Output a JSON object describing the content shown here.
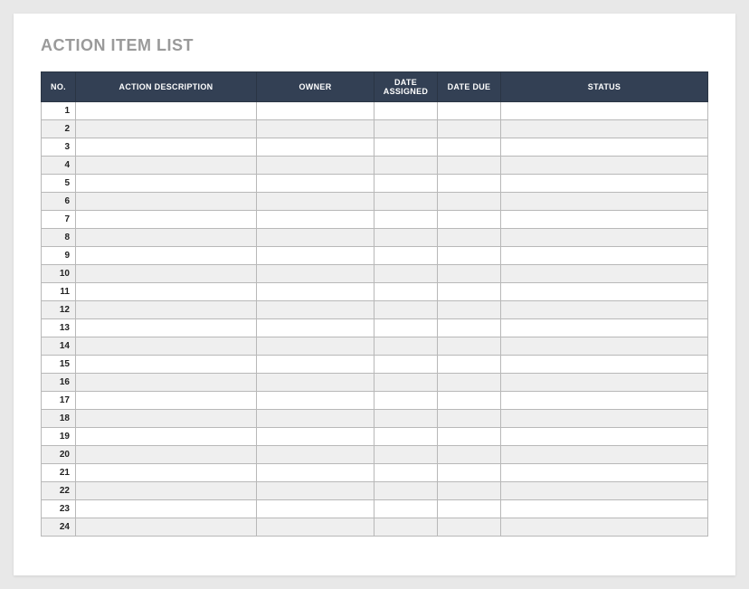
{
  "title": "ACTION ITEM LIST",
  "columns": {
    "no": "NO.",
    "description": "ACTION DESCRIPTION",
    "owner": "OWNER",
    "dateAssigned": "DATE ASSIGNED",
    "dateDue": "DATE DUE",
    "status": "STATUS"
  },
  "rows": [
    {
      "no": "1",
      "description": "",
      "owner": "",
      "dateAssigned": "",
      "dateDue": "",
      "status": ""
    },
    {
      "no": "2",
      "description": "",
      "owner": "",
      "dateAssigned": "",
      "dateDue": "",
      "status": ""
    },
    {
      "no": "3",
      "description": "",
      "owner": "",
      "dateAssigned": "",
      "dateDue": "",
      "status": ""
    },
    {
      "no": "4",
      "description": "",
      "owner": "",
      "dateAssigned": "",
      "dateDue": "",
      "status": ""
    },
    {
      "no": "5",
      "description": "",
      "owner": "",
      "dateAssigned": "",
      "dateDue": "",
      "status": ""
    },
    {
      "no": "6",
      "description": "",
      "owner": "",
      "dateAssigned": "",
      "dateDue": "",
      "status": ""
    },
    {
      "no": "7",
      "description": "",
      "owner": "",
      "dateAssigned": "",
      "dateDue": "",
      "status": ""
    },
    {
      "no": "8",
      "description": "",
      "owner": "",
      "dateAssigned": "",
      "dateDue": "",
      "status": ""
    },
    {
      "no": "9",
      "description": "",
      "owner": "",
      "dateAssigned": "",
      "dateDue": "",
      "status": ""
    },
    {
      "no": "10",
      "description": "",
      "owner": "",
      "dateAssigned": "",
      "dateDue": "",
      "status": ""
    },
    {
      "no": "11",
      "description": "",
      "owner": "",
      "dateAssigned": "",
      "dateDue": "",
      "status": ""
    },
    {
      "no": "12",
      "description": "",
      "owner": "",
      "dateAssigned": "",
      "dateDue": "",
      "status": ""
    },
    {
      "no": "13",
      "description": "",
      "owner": "",
      "dateAssigned": "",
      "dateDue": "",
      "status": ""
    },
    {
      "no": "14",
      "description": "",
      "owner": "",
      "dateAssigned": "",
      "dateDue": "",
      "status": ""
    },
    {
      "no": "15",
      "description": "",
      "owner": "",
      "dateAssigned": "",
      "dateDue": "",
      "status": ""
    },
    {
      "no": "16",
      "description": "",
      "owner": "",
      "dateAssigned": "",
      "dateDue": "",
      "status": ""
    },
    {
      "no": "17",
      "description": "",
      "owner": "",
      "dateAssigned": "",
      "dateDue": "",
      "status": ""
    },
    {
      "no": "18",
      "description": "",
      "owner": "",
      "dateAssigned": "",
      "dateDue": "",
      "status": ""
    },
    {
      "no": "19",
      "description": "",
      "owner": "",
      "dateAssigned": "",
      "dateDue": "",
      "status": ""
    },
    {
      "no": "20",
      "description": "",
      "owner": "",
      "dateAssigned": "",
      "dateDue": "",
      "status": ""
    },
    {
      "no": "21",
      "description": "",
      "owner": "",
      "dateAssigned": "",
      "dateDue": "",
      "status": ""
    },
    {
      "no": "22",
      "description": "",
      "owner": "",
      "dateAssigned": "",
      "dateDue": "",
      "status": ""
    },
    {
      "no": "23",
      "description": "",
      "owner": "",
      "dateAssigned": "",
      "dateDue": "",
      "status": ""
    },
    {
      "no": "24",
      "description": "",
      "owner": "",
      "dateAssigned": "",
      "dateDue": "",
      "status": ""
    }
  ]
}
